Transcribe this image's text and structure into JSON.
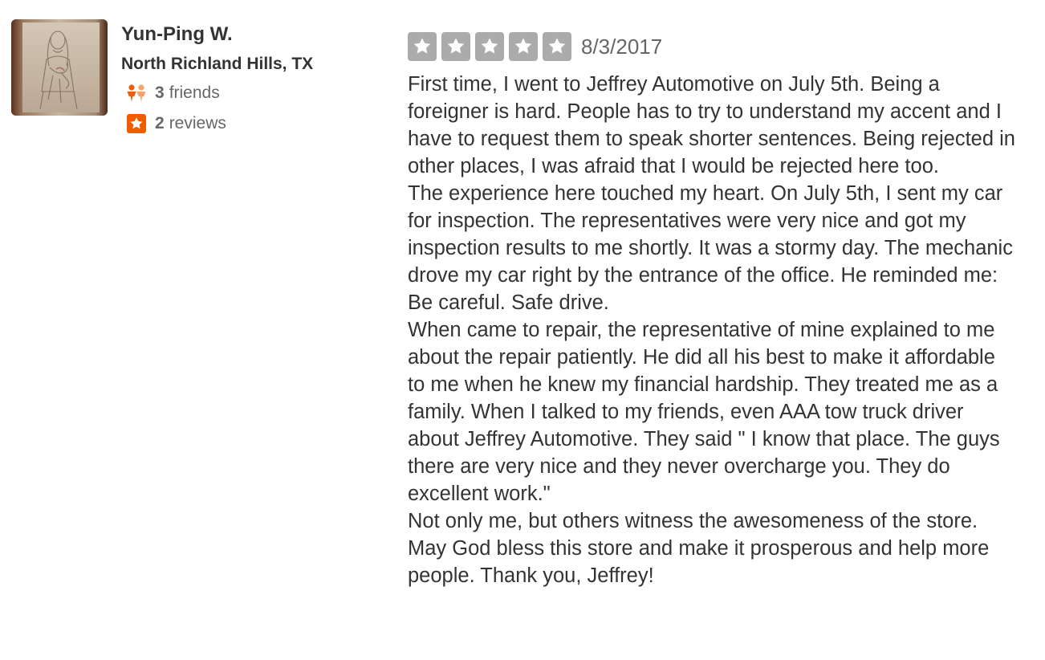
{
  "user": {
    "name": "Yun-Ping W.",
    "location": "North Richland Hills, TX",
    "friends_count": "3",
    "friends_label": "friends",
    "reviews_count": "2",
    "reviews_label": "reviews"
  },
  "review": {
    "rating": 5,
    "max_rating": 5,
    "date": "8/3/2017",
    "paragraphs": [
      "First time, I went to Jeffrey Automotive on July 5th. Being a foreigner is hard. People has to try to understand my accent and I have to request them to speak shorter sentences. Being rejected in other places, I was afraid that I would be rejected here too.",
      "The experience here touched my heart. On July 5th, I sent my car for inspection. The representatives were very nice and got my inspection results to me shortly. It was a stormy day. The mechanic drove my car right by the entrance of the office. He reminded me: Be careful. Safe drive.",
      "When came to repair, the representative of mine explained to me about the repair patiently. He did all his best to make it affordable to me when he knew my financial hardship. They treated me as a family. When I talked to my friends, even AAA tow truck driver about Jeffrey Automotive. They said \" I know that place. The guys there are very nice and they never overcharge you. They do excellent work.\"",
      "Not only me, but others witness the awesomeness of the store. May God bless this store and make it prosperous and help more people. Thank you, Jeffrey!"
    ]
  },
  "icons": {
    "friends": "friends-icon",
    "reviews": "review-star-icon",
    "rating_star": "star-icon"
  },
  "colors": {
    "star_empty": "#ababab",
    "friends_icon": "#f15c00",
    "friends_icon_light": "#f9a26b",
    "reviews_icon": "#f15c00",
    "text": "#333333",
    "muted": "#666666"
  }
}
